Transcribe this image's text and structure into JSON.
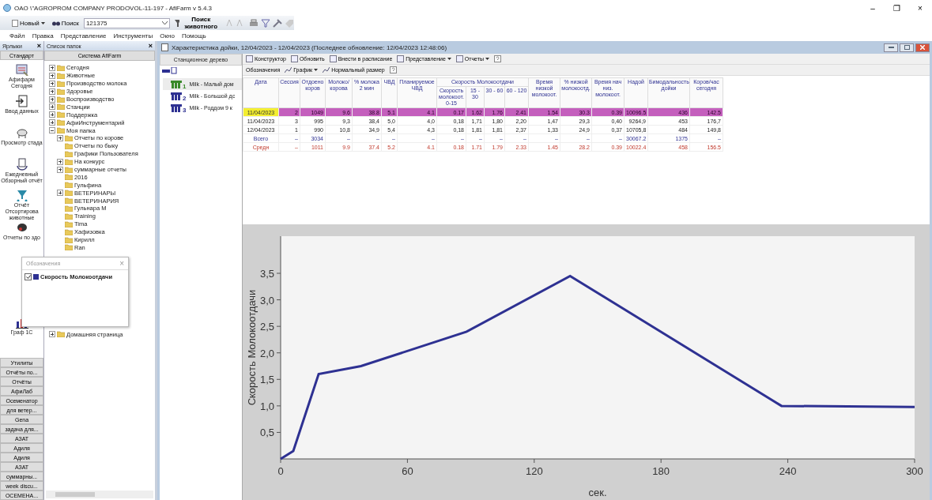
{
  "window": {
    "title": "OAO \\\"AGROPROM COMPANY PRODOVOL-11-197 - AfiFarm v 5.4.3",
    "controls": [
      "–",
      "❐",
      "×"
    ]
  },
  "toolbar": {
    "new": "Новый",
    "search": "Поиск",
    "search_value": "121375",
    "animal_search": "Поиск животного"
  },
  "menu": [
    "Файл",
    "Правка",
    "Представление",
    "Инструменты",
    "Окно",
    "Помощь"
  ],
  "shortcuts": {
    "title": "Ярлыки",
    "close": "×",
    "group": "Стандарт",
    "items": [
      {
        "label": "Афифарм Сегодня"
      },
      {
        "label": "Ввод данных"
      },
      {
        "label": "Просмотр стада"
      },
      {
        "label": "Ежедневный Обзорный отчёт"
      },
      {
        "label": "Отчёт Отсортирова животные"
      },
      {
        "label": "Отчеты по здо"
      },
      {
        "label": "Граф 1С"
      }
    ],
    "groups": [
      "Утилиты",
      "Отчёты по...",
      "Отчёты",
      "АфиЛаб",
      "Осеменатор",
      "для ветер...",
      "Gena",
      "задача для...",
      "АЗАТ",
      "Адиля",
      "Адиля",
      "АЗАТ",
      "суммарны...",
      "week discu...",
      "ОСЕМЕНА..."
    ]
  },
  "folders": {
    "title": "Список папок",
    "close": "×",
    "root": "Система AfiFarm",
    "items": [
      {
        "label": "Сегодня",
        "expanded": false
      },
      {
        "label": "Животные",
        "expanded": false
      },
      {
        "label": "Производство молока",
        "expanded": false
      },
      {
        "label": "Здоровье",
        "expanded": false
      },
      {
        "label": "Воспроизводство",
        "expanded": false
      },
      {
        "label": "Станции",
        "expanded": false
      },
      {
        "label": "Поддержка",
        "expanded": false
      },
      {
        "label": "АфиИнструментарий",
        "expanded": false
      },
      {
        "label": "Моя папка",
        "expanded": true,
        "children": [
          {
            "label": "Отчеты по корове",
            "expanded": false
          },
          {
            "label": "Отчеты по быку"
          },
          {
            "label": "Графики Пользователя"
          },
          {
            "label": "На конкурс",
            "expanded": false
          },
          {
            "label": "суммарные отчеты",
            "expanded": false
          },
          {
            "label": "2016"
          },
          {
            "label": "Гульфина"
          },
          {
            "label": "ВЕТЕРИНАРЫ",
            "expanded": false
          },
          {
            "label": "ВЕТЕРИНАРИЯ"
          },
          {
            "label": "Гульнара М"
          },
          {
            "label": "Training"
          },
          {
            "label": "Tima"
          },
          {
            "label": "Хафизовка"
          },
          {
            "label": "Кирилл"
          },
          {
            "label": "Ran"
          }
        ]
      }
    ],
    "bottom": [
      {
        "label": "Домашняя страница",
        "expanded": false
      }
    ]
  },
  "report": {
    "title": "Характеристика дойки, 12/04/2023 - 12/04/2023 (Последнее обновление: 12/04/2023 12:48:06)",
    "station_tree": {
      "title": "Станционное дерево",
      "items": [
        {
          "label": "Milk - Малый дом",
          "index": "1",
          "selected": true,
          "color": "#3a8a2a"
        },
        {
          "label": "Milk - Большой дс",
          "index": "2",
          "selected": false,
          "color": "#2e3192"
        },
        {
          "label": "Milk - Роддом 9 к",
          "index": "3",
          "selected": false,
          "color": "#2e3192"
        }
      ]
    },
    "toolbar1": [
      "Конструктор",
      "Обновить",
      "Внести в расписание",
      "Представление",
      "Отчеты"
    ],
    "toolbar2": [
      "Обозначения",
      "График",
      "Нормальный размер"
    ],
    "table": {
      "group": "Скорость Молокоотдачи",
      "columns": [
        "Дата",
        "Сессия",
        "Отдоено коров",
        "Молоко/ корова",
        "% молока 2 мин",
        "ЧВД",
        "Планируемое ЧВД",
        "Скорость молокоот. 0-15",
        "15 - 30",
        "30 - 60",
        "60 - 120",
        "Время низкой молокоот.",
        "% низкой молокоотд.",
        "Время нач низ. молокоот.",
        "Надой",
        "Бимодальность дойки",
        "Коров/час сегодня"
      ],
      "rows": [
        {
          "kind": "selected",
          "cells": [
            "11/04/2023",
            "2",
            "1049",
            "9.6",
            "38.8",
            "5.1",
            "4.1",
            "0.17",
            "1.62",
            "1.76",
            "2.41",
            "1.54",
            "30.3",
            "0.39",
            "10096.5",
            "436",
            "142.5"
          ]
        },
        {
          "kind": "normal",
          "cells": [
            "11/04/2023",
            "3",
            "995",
            "9,3",
            "38,4",
            "5,0",
            "4,0",
            "0,18",
            "1,71",
            "1,80",
            "2,20",
            "1,47",
            "29,3",
            "0,40",
            "9264,9",
            "453",
            "176,7"
          ]
        },
        {
          "kind": "normal",
          "cells": [
            "12/04/2023",
            "1",
            "990",
            "10,8",
            "34,9",
            "5,4",
            "4,3",
            "0,18",
            "1,81",
            "1,81",
            "2,37",
            "1,33",
            "24,9",
            "0,37",
            "10705,8",
            "484",
            "149,8"
          ]
        },
        {
          "kind": "total",
          "cells": [
            "Всего",
            "–",
            "3034",
            "–",
            "–",
            "–",
            "–",
            "–",
            "–",
            "–",
            "–",
            "–",
            "–",
            "–",
            "30067.2",
            "1375",
            "–"
          ]
        },
        {
          "kind": "average",
          "cells": [
            "Средн",
            "–",
            "1011",
            "9.9",
            "37.4",
            "5.2",
            "4.1",
            "0.18",
            "1.71",
            "1.79",
            "2.33",
            "1.45",
            "28.2",
            "0.39",
            "10022.4",
            "458",
            "156.5"
          ]
        }
      ]
    },
    "chart_data": {
      "type": "line",
      "xlabel": "сек.",
      "ylabel": "Скорость Молокоотдачи",
      "x": [
        0,
        6,
        18,
        38,
        88,
        137,
        237,
        300
      ],
      "series": [
        {
          "name": "Скорость Молокоотдачи",
          "color": "#2e3192",
          "values": [
            0,
            0.15,
            1.6,
            1.75,
            2.4,
            3.45,
            1.0,
            0.98
          ]
        }
      ],
      "xlim": [
        0,
        300
      ],
      "ylim": [
        0,
        4.2
      ],
      "xticks": [
        0,
        60,
        120,
        180,
        240,
        300
      ],
      "yticks": [
        {
          "value": 0.5,
          "label": "0,5"
        },
        {
          "value": 1,
          "label": "1,0"
        },
        {
          "value": 1.5,
          "label": "1,5"
        },
        {
          "value": 2,
          "label": "2,0"
        },
        {
          "value": 2.5,
          "label": "2,5"
        },
        {
          "value": 3,
          "label": "3,0"
        },
        {
          "value": 3.5,
          "label": "3,5"
        }
      ]
    },
    "legend": {
      "title": "Обозначения",
      "close": "×",
      "items": [
        {
          "checked": true
        }
      ]
    }
  }
}
